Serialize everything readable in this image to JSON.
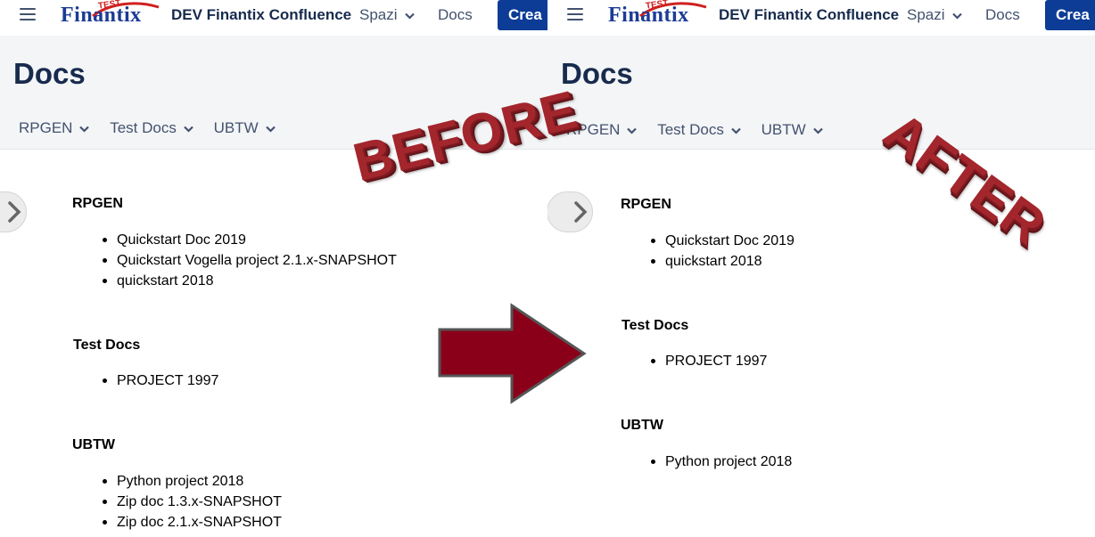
{
  "brand": {
    "logo_text": "Finantix",
    "logo_badge": "TEST",
    "site_title": "DEV Finantix Confluence",
    "accent_color": "#0c3c96"
  },
  "nav": {
    "spazi": "Spazi",
    "docs": "Docs",
    "crea": "Crea"
  },
  "space": {
    "title": "Docs",
    "subnav": [
      "RPGEN",
      "Test Docs",
      "UBTW"
    ]
  },
  "labels": {
    "before": "BEFORE",
    "after": "AFTER"
  },
  "before": {
    "sections": [
      {
        "title": "RPGEN",
        "items": [
          "Quickstart Doc 2019",
          "Quickstart Vogella project 2.1.x-SNAPSHOT",
          "quickstart 2018"
        ]
      },
      {
        "title": "Test Docs",
        "items": [
          "PROJECT 1997"
        ]
      },
      {
        "title": "UBTW",
        "items": [
          "Python project 2018",
          "Zip doc 1.3.x-SNAPSHOT",
          "Zip doc 2.1.x-SNAPSHOT"
        ]
      }
    ]
  },
  "after": {
    "sections": [
      {
        "title": "RPGEN",
        "items": [
          "Quickstart Doc 2019",
          "quickstart 2018"
        ]
      },
      {
        "title": "Test Docs",
        "items": [
          "PROJECT 1997"
        ]
      },
      {
        "title": "UBTW",
        "items": [
          "Python project 2018"
        ]
      }
    ]
  },
  "icons": {
    "menu": "hamburger-icon",
    "dropdown": "chevron-down-icon",
    "expand": "chevron-right-icon",
    "transition": "arrow-right-icon"
  },
  "colors": {
    "stamp": "#a3262d",
    "arrow": "#8b0019"
  }
}
